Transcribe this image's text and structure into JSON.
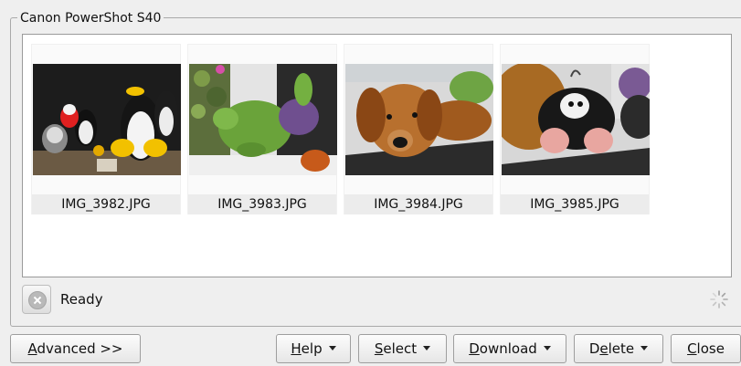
{
  "group": {
    "title": "Canon PowerShot S40"
  },
  "thumbnails": [
    {
      "filename": "IMG_3982.JPG"
    },
    {
      "filename": "IMG_3983.JPG"
    },
    {
      "filename": "IMG_3984.JPG"
    },
    {
      "filename": "IMG_3985.JPG"
    }
  ],
  "status": {
    "text": "Ready"
  },
  "buttons": {
    "advanced": {
      "prefix": "",
      "mnemonic": "A",
      "rest": "dvanced >>"
    },
    "help": {
      "prefix": "",
      "mnemonic": "H",
      "rest": "elp"
    },
    "select": {
      "prefix": "",
      "mnemonic": "S",
      "rest": "elect"
    },
    "download": {
      "prefix": "",
      "mnemonic": "D",
      "rest": "ownload"
    },
    "delete": {
      "prefix": "D",
      "mnemonic": "e",
      "rest": "lete"
    },
    "close": {
      "prefix": "",
      "mnemonic": "C",
      "rest": "lose"
    }
  },
  "icons": {
    "stop": "stop-icon",
    "busy": "busy-spinner-icon",
    "dropdown": "chevron-down-icon"
  }
}
